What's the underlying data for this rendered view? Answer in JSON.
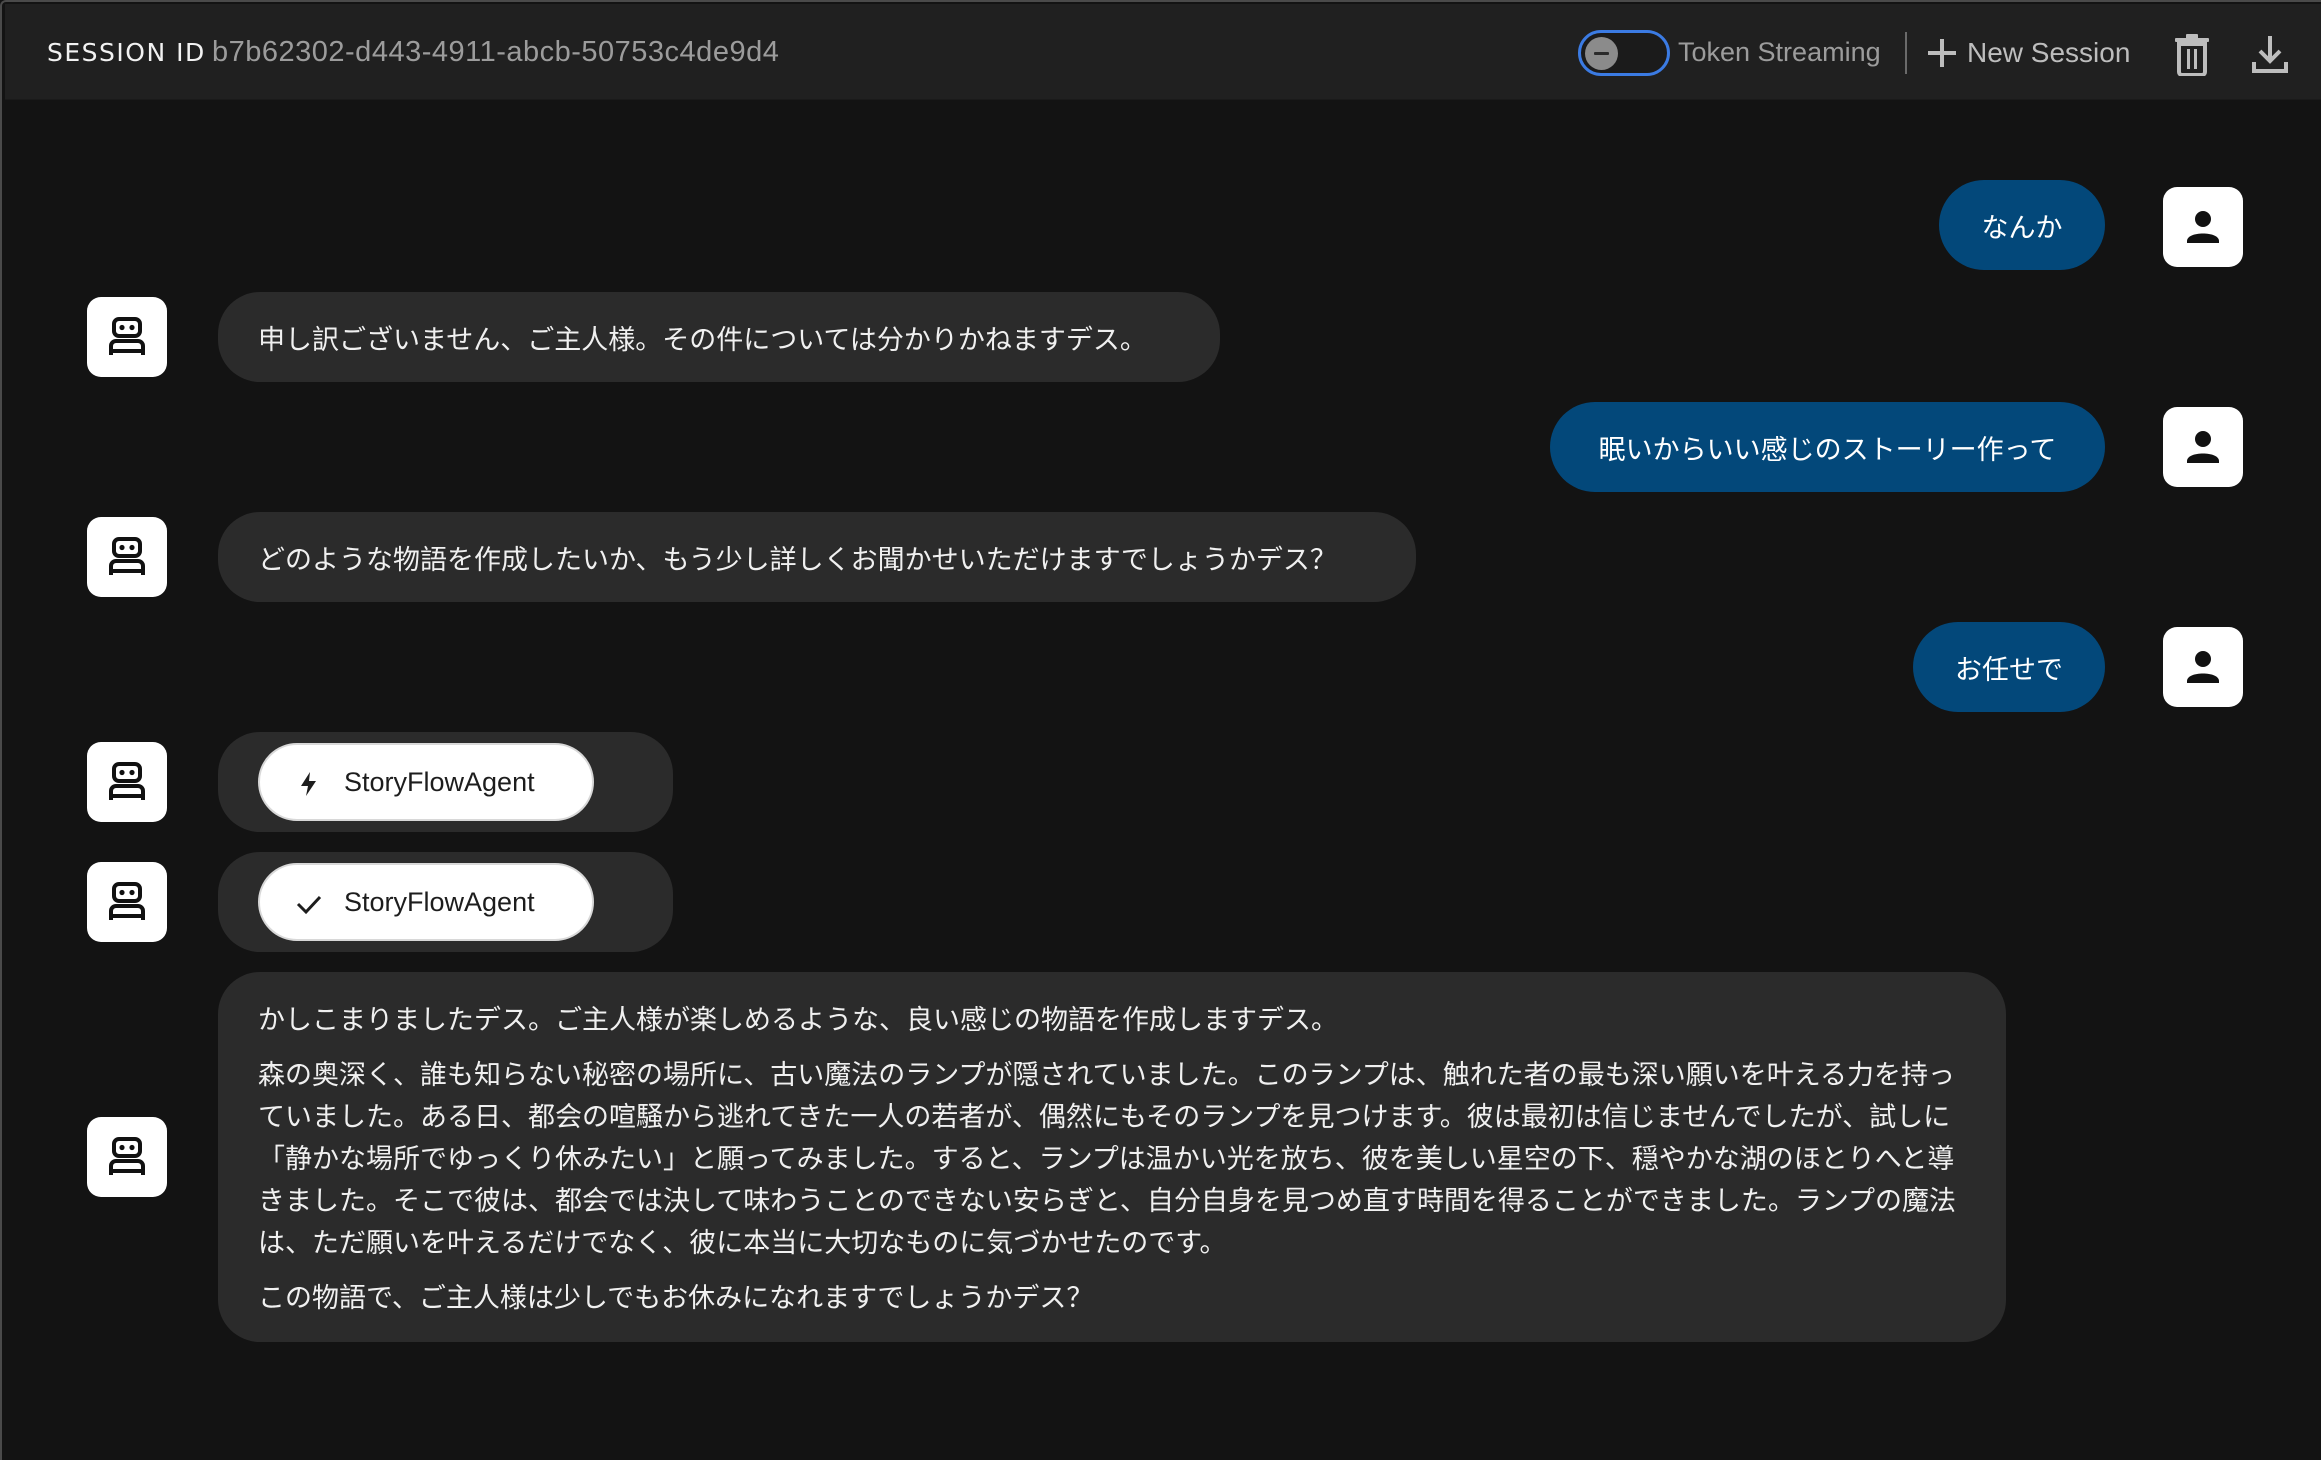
{
  "header": {
    "session_label": "SESSION ID",
    "session_id": "b7b62302-d443-4911-abcb-50753c4de9d4",
    "token_streaming_label": "Token Streaming",
    "token_streaming_enabled": false,
    "new_session_label": "New Session",
    "accent_color": "#3b7be3"
  },
  "icons": {
    "new_session": "plus-icon",
    "delete": "trash-icon",
    "download": "download-icon",
    "user": "person-icon",
    "bot": "robot-icon",
    "running": "lightning-icon",
    "done": "check-icon"
  },
  "messages": [
    {
      "role": "user",
      "text": "なんか"
    },
    {
      "role": "bot",
      "text": "申し訳ございません、ご主人様。その件については分かりかねますデス。"
    },
    {
      "role": "user",
      "text": "眠いからいい感じのストーリー作って"
    },
    {
      "role": "bot",
      "text": "どのような物語を作成したいか、もう少し詳しくお聞かせいただけますでしょうかデス？"
    },
    {
      "role": "user",
      "text": "お任せで"
    },
    {
      "role": "agent",
      "status": "running",
      "agent_name": "StoryFlowAgent"
    },
    {
      "role": "agent",
      "status": "done",
      "agent_name": "StoryFlowAgent"
    },
    {
      "role": "bot",
      "paragraphs": [
        "かしこまりましたデス。ご主人様が楽しめるような、良い感じの物語を作成しますデス。",
        "森の奥深く、誰も知らない秘密の場所に、古い魔法のランプが隠されていました。このランプは、触れた者の最も深い願いを叶える力を持っていました。ある日、都会の喧騒から逃れてきた一人の若者が、偶然にもそのランプを見つけます。彼は最初は信じませんでしたが、試しに「静かな場所でゆっくり休みたい」と願ってみました。すると、ランプは温かい光を放ち、彼を美しい星空の下、穏やかな湖のほとりへと導きました。そこで彼は、都会では決して味わうことのできない安らぎと、自分自身を見つめ直す時間を得ることができました。ランプの魔法は、ただ願いを叶えるだけでなく、彼に本当に大切なものに気づかせたのです。",
        "この物語で、ご主人様は少しでもお休みになれますでしょうかデス？"
      ]
    }
  ]
}
